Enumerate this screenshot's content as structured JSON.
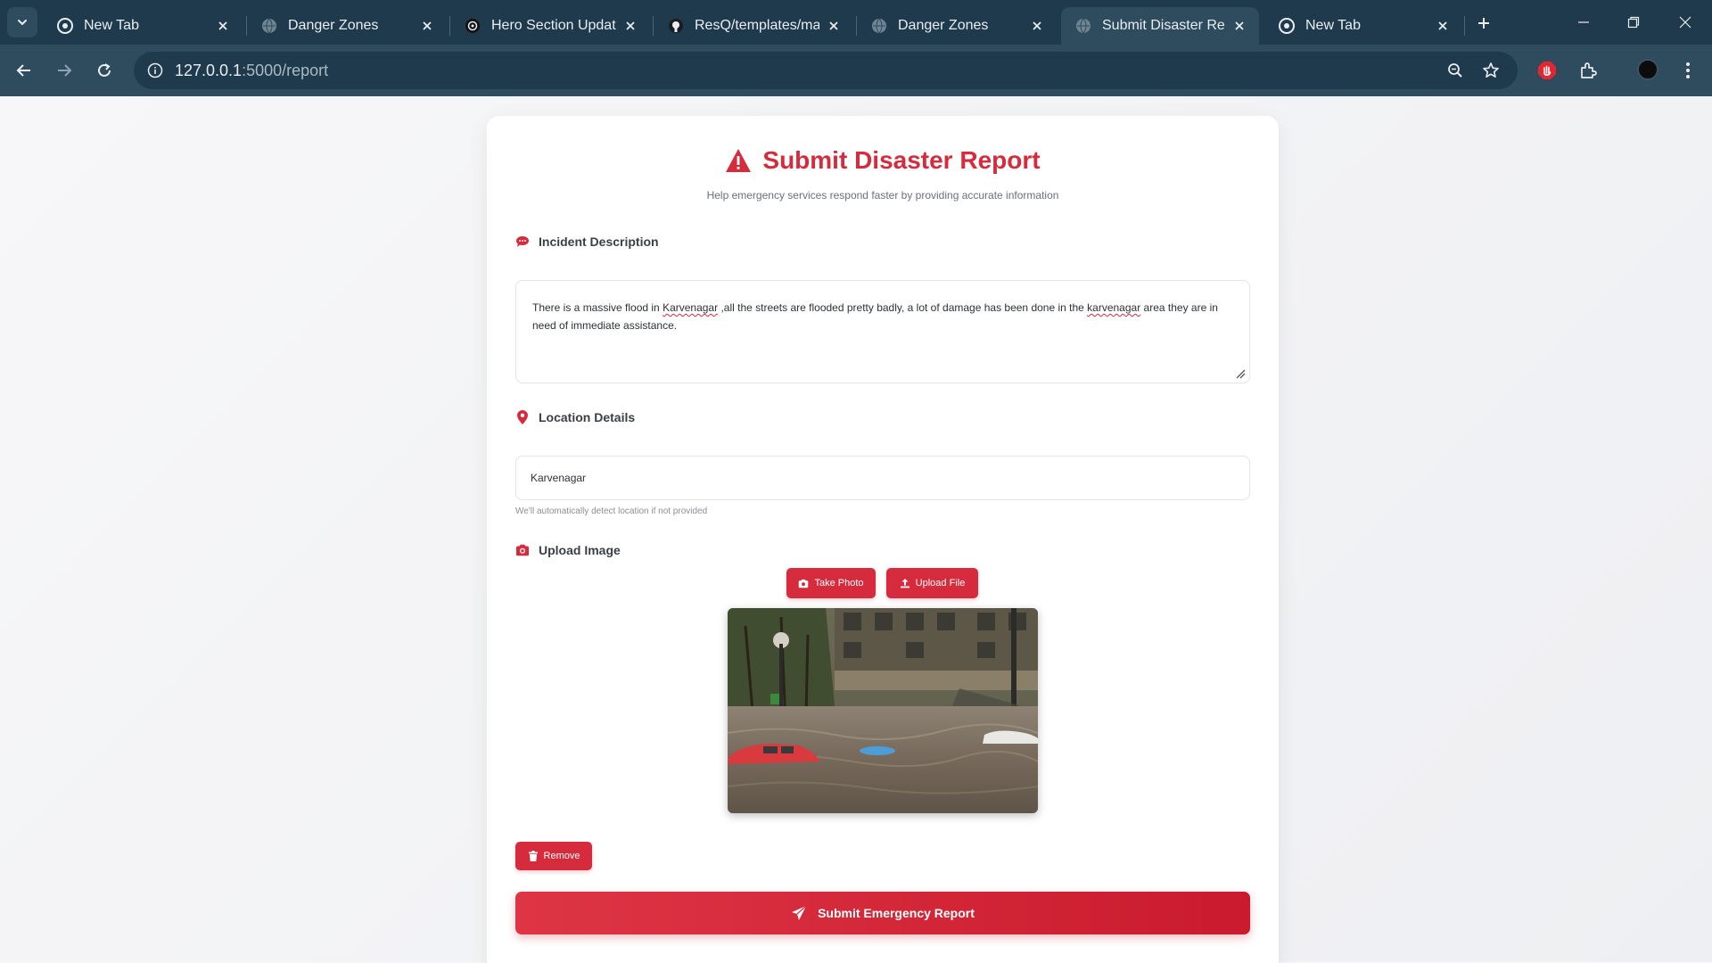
{
  "browser": {
    "tabs": [
      {
        "title": "New Tab",
        "favicon": "chrome-icon",
        "active": false
      },
      {
        "title": "Danger Zones",
        "favicon": "globe-icon",
        "active": false
      },
      {
        "title": "Hero Section Update",
        "favicon": "openai-icon",
        "active": false
      },
      {
        "title": "ResQ/templates/map",
        "favicon": "github-icon",
        "active": false
      },
      {
        "title": "Danger Zones",
        "favicon": "globe-icon",
        "active": false
      },
      {
        "title": "Submit Disaster Repo",
        "favicon": "globe-icon",
        "active": true
      },
      {
        "title": "New Tab",
        "favicon": "chrome-icon",
        "active": false
      }
    ],
    "url_host": "127.0.0.1",
    "url_path": ":5000/report"
  },
  "page": {
    "title": "Submit Disaster Report",
    "subtitle": "Help emergency services respond faster by providing accurate information",
    "description_label": "Incident Description",
    "description_value_parts": [
      "There is a massive flood in ",
      "Karvenagar",
      " ,all the streets are flooded pretty badly, a lot of damage has been done in the ",
      "karvenagar",
      " area they are in need of immediate assistance."
    ],
    "location_label": "Location Details",
    "location_value": "Karvenagar",
    "location_hint": "We'll automatically detect location if not provided",
    "upload_label": "Upload Image",
    "take_photo_label": "Take Photo",
    "upload_file_label": "Upload File",
    "remove_label": "Remove",
    "submit_label": "Submit Emergency Report"
  },
  "colors": {
    "accent": "#d62b3c",
    "chrome_dark": "#1f3a4c",
    "chrome_mid": "#2f4b5e"
  }
}
